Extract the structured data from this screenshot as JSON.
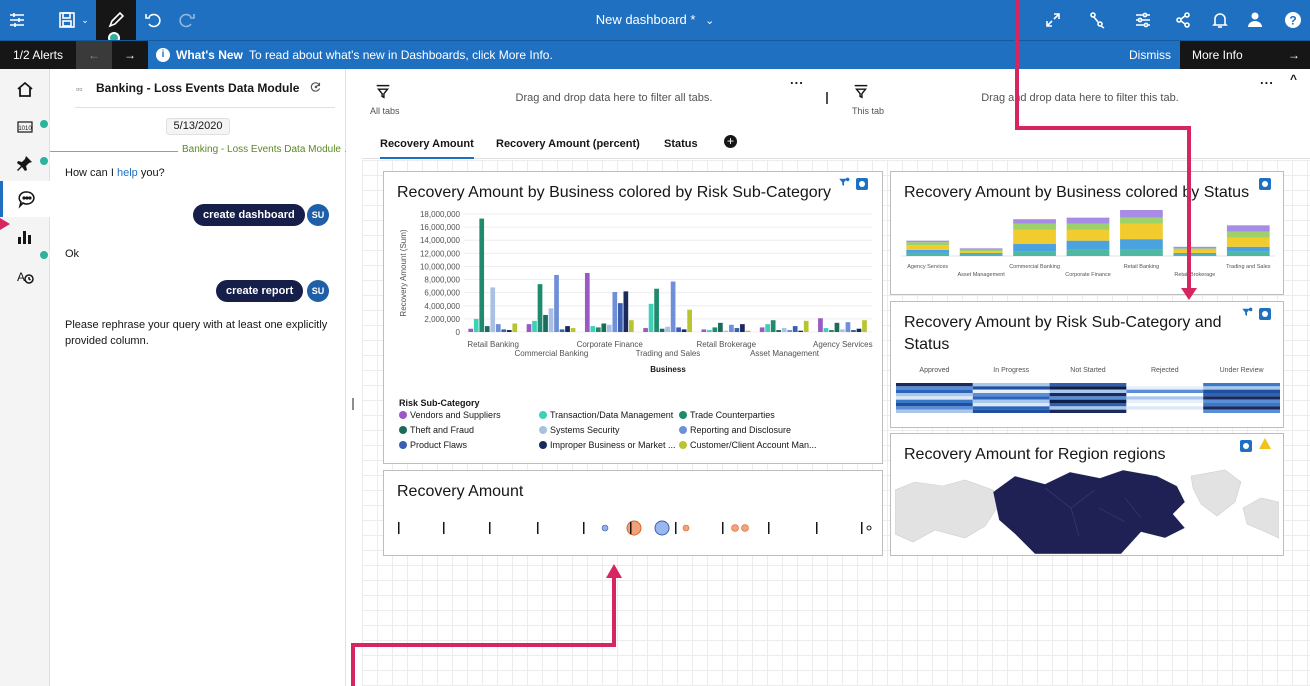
{
  "topbar": {
    "title": "New dashboard *"
  },
  "alert": {
    "count": "1/2 Alerts",
    "heading": "What's New",
    "text": "To read about what's new in Dashboards, click More Info.",
    "dismiss": "Dismiss",
    "more_info": "More Info"
  },
  "assistant": {
    "title": "Banking - Loss Events Data Module",
    "date": "5/13/2020",
    "module_rule": "Banking - Loss Events Data Module",
    "greeting_pre": "How can I ",
    "greeting_link": "help",
    "greeting_post": " you?",
    "create_dashboard": "create dashboard",
    "avatar": "SU",
    "ok": "Ok",
    "create_report": "create report",
    "rephrase": "Please rephrase your query with at least one explicitly provided column."
  },
  "filters": {
    "all_tabs_label": "All tabs",
    "all_tabs_text": "Drag and drop data here to filter all tabs.",
    "this_tab_label": "This tab",
    "this_tab_text": "Drag and drop data here to filter this tab.",
    "dots": "...",
    "collapse": "^"
  },
  "tabs": [
    "Recovery Amount",
    "Recovery Amount (percent)",
    "Status"
  ],
  "widgets": {
    "main_title": "Recovery Amount by Business colored by Risk Sub-Category",
    "status_title": "Recovery Amount by Business colored by Status",
    "heatmap_title": "Recovery Amount by Risk Sub-Category and Status",
    "map_title": "Recovery Amount for Region regions",
    "recovery_title": "Recovery Amount"
  },
  "chart_data": [
    {
      "type": "bar",
      "title": "Recovery Amount by Business colored by Risk Sub-Category",
      "xlabel": "Business",
      "ylabel": "Recovery Amount (Sum)",
      "ylim": [
        0,
        18000000
      ],
      "yticks": [
        "18,000,000",
        "16,000,000",
        "14,000,000",
        "12,000,000",
        "10,000,000",
        "8,000,000",
        "6,000,000",
        "4,000,000",
        "2,000,000",
        "0"
      ],
      "grid": true,
      "legend_title": "Risk Sub-Category",
      "legend_position": "bottom",
      "categories": [
        "Retail Banking",
        "Commercial Banking",
        "Corporate Finance",
        "Trading and Sales",
        "Retail Brokerage",
        "Asset Management",
        "Agency Services"
      ],
      "series": [
        {
          "name": "Vendors and Suppliers",
          "color": "#9b59c6",
          "values": [
            500000,
            1200000,
            9000000,
            600000,
            400000,
            700000,
            2100000
          ]
        },
        {
          "name": "Transaction/Data Management",
          "color": "#3fd1b5",
          "values": [
            2000000,
            1700000,
            900000,
            4300000,
            300000,
            1200000,
            600000
          ]
        },
        {
          "name": "Trade Counterparties",
          "color": "#1f8a6e",
          "values": [
            17300000,
            7300000,
            700000,
            6600000,
            700000,
            1800000,
            300000
          ]
        },
        {
          "name": "Theft and Fraud",
          "color": "#1d6b5a",
          "values": [
            900000,
            2600000,
            1300000,
            500000,
            1400000,
            300000,
            1400000
          ]
        },
        {
          "name": "Systems Security",
          "color": "#a9bfe3",
          "values": [
            6800000,
            3600000,
            1100000,
            800000,
            200000,
            600000,
            400000
          ]
        },
        {
          "name": "Reporting and Disclosure",
          "color": "#6f8fd8",
          "values": [
            1200000,
            8700000,
            6100000,
            7700000,
            1100000,
            300000,
            1500000
          ]
        },
        {
          "name": "Product Flaws",
          "color": "#3b5fb0",
          "values": [
            400000,
            400000,
            4400000,
            700000,
            600000,
            900000,
            300000
          ]
        },
        {
          "name": "Improper Business or Market ...",
          "color": "#1b2a5c",
          "values": [
            300000,
            900000,
            6200000,
            400000,
            1200000,
            200000,
            500000
          ]
        },
        {
          "name": "Customer/Client Account Man...",
          "color": "#b8c531",
          "values": [
            1300000,
            600000,
            1800000,
            3400000,
            200000,
            1700000,
            1800000
          ]
        }
      ]
    },
    {
      "type": "bar",
      "title": "Recovery Amount by Business colored by Status",
      "categories": [
        "Agency Services",
        "Asset Management",
        "Commercial Banking",
        "Corporate Finance",
        "Retail Banking",
        "Retail Brokerage",
        "Trading and Sales"
      ],
      "stacked": true,
      "series": [
        {
          "name": "Approved",
          "color": "#4fb8a3",
          "values": [
            2,
            1,
            3,
            4,
            4,
            1,
            3
          ]
        },
        {
          "name": "In Progress",
          "color": "#4aa3df",
          "values": [
            2,
            1,
            5,
            6,
            7,
            1,
            3
          ]
        },
        {
          "name": "Not Started",
          "color": "#f2cc2e",
          "values": [
            3,
            1,
            9,
            7,
            10,
            2,
            6
          ]
        },
        {
          "name": "Rejected",
          "color": "#9bd36a",
          "values": [
            2,
            1,
            4,
            4,
            4,
            1,
            4
          ]
        },
        {
          "name": "Under Review",
          "color": "#a78ce6",
          "values": [
            1,
            1,
            3,
            4,
            5,
            1,
            4
          ]
        }
      ]
    },
    {
      "type": "heatmap",
      "title": "Recovery Amount by Risk Sub-Category and Status",
      "x": [
        "Approved",
        "In Progress",
        "Not Started",
        "Rejected",
        "Under Review"
      ]
    }
  ]
}
